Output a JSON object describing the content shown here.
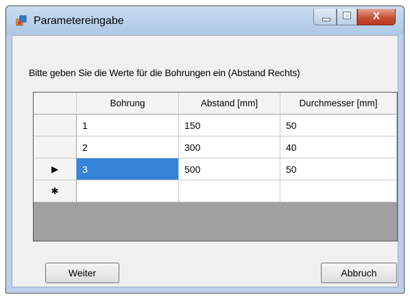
{
  "window": {
    "title": "Parametereingabe",
    "controls": {
      "minimize_icon": "minimize-icon",
      "maximize_icon": "maximize-icon",
      "close_glyph": "X"
    }
  },
  "prompt": "Bitte geben Sie die Werte für die Bohrungen ein (Abstand Rechts)",
  "grid": {
    "columns": [
      "Bohrung",
      "Abstand [mm]",
      "Durchmesser [mm]"
    ],
    "rows": [
      {
        "indicator": "",
        "cells": [
          "1",
          "150",
          "50"
        ]
      },
      {
        "indicator": "",
        "cells": [
          "2",
          "300",
          "40"
        ]
      },
      {
        "indicator": "▶",
        "cells": [
          "3",
          "500",
          "50"
        ]
      },
      {
        "indicator": "✱",
        "cells": [
          "",
          "",
          ""
        ]
      }
    ],
    "selected_color": "#3584d8"
  },
  "buttons": {
    "next": "Weiter",
    "cancel": "Abbruch"
  }
}
